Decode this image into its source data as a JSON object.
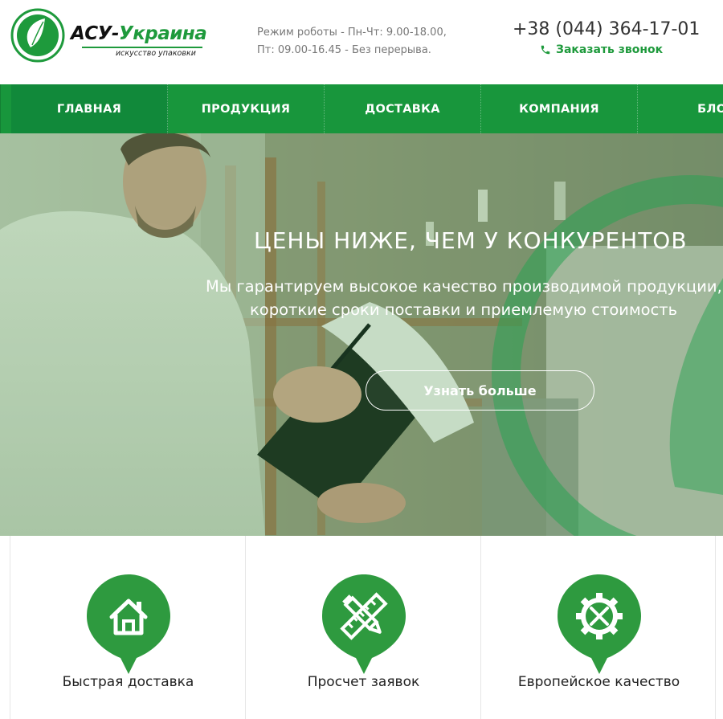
{
  "brand": {
    "name_part1": "АСУ-",
    "name_part2": "Украина",
    "tagline": "искусство упаковки",
    "green": "#1e9a3c"
  },
  "header": {
    "hours_line1": "Режим роботы - Пн-Чт: 9.00-18.00,",
    "hours_line2": "Пт: 09.00-16.45 - Без перерыва.",
    "phone": "+38 (044) 364-17-01",
    "callback_label": "Заказать звонок",
    "callback_icon": "phone-icon"
  },
  "nav": {
    "items": [
      {
        "label": "ГЛАВНАЯ"
      },
      {
        "label": "ПРОДУКЦИЯ"
      },
      {
        "label": "ДОСТАВКА"
      },
      {
        "label": "КОМПАНИЯ"
      },
      {
        "label": "БЛОГ"
      }
    ],
    "color": "#18963c"
  },
  "hero": {
    "title": "ЦЕНЫ НИЖЕ, ЧЕМ У КОНКУРЕНТОВ",
    "subtitle_line1": "Мы гарантируем высокое качество производимой продукции,",
    "subtitle_line2": "короткие сроки поставки и приемлемую стоимость",
    "button_label": "Узнать больше"
  },
  "features": [
    {
      "label": "Быстрая доставка",
      "icon": "house-icon"
    },
    {
      "label": "Просчет заявок",
      "icon": "pencil-ruler-icon"
    },
    {
      "label": "Европейское качество",
      "icon": "gear-wrench-icon"
    }
  ]
}
